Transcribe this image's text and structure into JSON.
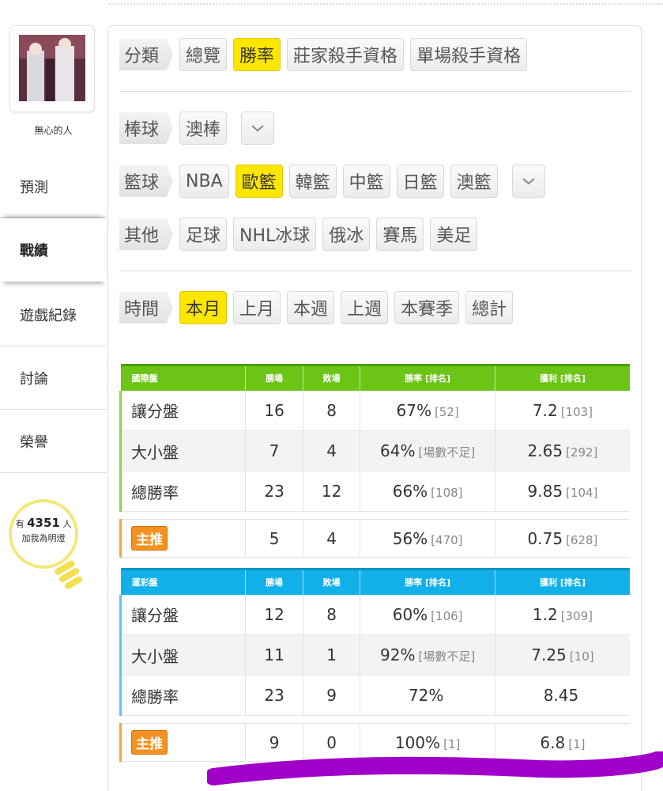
{
  "user": {
    "name": "無心的人"
  },
  "sidebar": {
    "items": [
      {
        "label": "預測"
      },
      {
        "label": "戰績"
      },
      {
        "label": "遊戲紀錄"
      },
      {
        "label": "討論"
      },
      {
        "label": "榮譽"
      }
    ],
    "fans": {
      "prefix": "有",
      "count": "4351",
      "suffix": "人",
      "caption": "加我為明燈"
    }
  },
  "filters": {
    "category": {
      "label": "分類",
      "options": [
        "總覽",
        "勝率",
        "莊家殺手資格",
        "單場殺手資格"
      ],
      "selected": "勝率"
    },
    "baseball": {
      "label": "棒球",
      "options": [
        "澳棒"
      ]
    },
    "basketball": {
      "label": "籃球",
      "options": [
        "NBA",
        "歐籃",
        "韓籃",
        "中籃",
        "日籃",
        "澳籃"
      ],
      "selected": "歐籃"
    },
    "other": {
      "label": "其他",
      "options": [
        "足球",
        "NHL冰球",
        "俄冰",
        "賽馬",
        "美足"
      ]
    },
    "time": {
      "label": "時間",
      "options": [
        "本月",
        "上月",
        "本週",
        "上週",
        "本賽季",
        "總計"
      ],
      "selected": "本月"
    }
  },
  "colors": {
    "accent_yellow": "#ffe600",
    "green_header": "#6cc417",
    "blue_header": "#12b0e8",
    "promo_orange": "#f39221",
    "marker_purple": "#a000c8"
  },
  "tables": [
    {
      "title": "國際盤",
      "headers": [
        "勝場",
        "敗場",
        "勝率 [排名]",
        "獲利 [排名]"
      ],
      "rows": [
        {
          "name": "讓分盤",
          "win": "16",
          "loss": "8",
          "rate": "67%",
          "rate_rank": "[52]",
          "profit": "7.2",
          "profit_rank": "[103]"
        },
        {
          "name": "大小盤",
          "win": "7",
          "loss": "4",
          "rate": "64%",
          "rate_rank": "[場數不足]",
          "profit": "2.65",
          "profit_rank": "[292]"
        },
        {
          "name": "總勝率",
          "win": "23",
          "loss": "12",
          "rate": "66%",
          "rate_rank": "[108]",
          "profit": "9.85",
          "profit_rank": "[104]"
        }
      ],
      "promo": {
        "label": "主推",
        "win": "5",
        "loss": "4",
        "rate": "56%",
        "rate_rank": "[470]",
        "profit": "0.75",
        "profit_rank": "[628]"
      }
    },
    {
      "title": "運彩盤",
      "headers": [
        "勝場",
        "敗場",
        "勝率 [排名]",
        "獲利 [排名]"
      ],
      "rows": [
        {
          "name": "讓分盤",
          "win": "12",
          "loss": "8",
          "rate": "60%",
          "rate_rank": "[106]",
          "profit": "1.2",
          "profit_rank": "[309]"
        },
        {
          "name": "大小盤",
          "win": "11",
          "loss": "1",
          "rate": "92%",
          "rate_rank": "[場數不足]",
          "profit": "7.25",
          "profit_rank": "[10]"
        },
        {
          "name": "總勝率",
          "win": "23",
          "loss": "9",
          "rate": "72%",
          "rate_rank": "",
          "profit": "8.45",
          "profit_rank": ""
        }
      ],
      "promo": {
        "label": "主推",
        "win": "9",
        "loss": "0",
        "rate": "100%",
        "rate_rank": "[1]",
        "profit": "6.8",
        "profit_rank": "[1]"
      }
    }
  ]
}
